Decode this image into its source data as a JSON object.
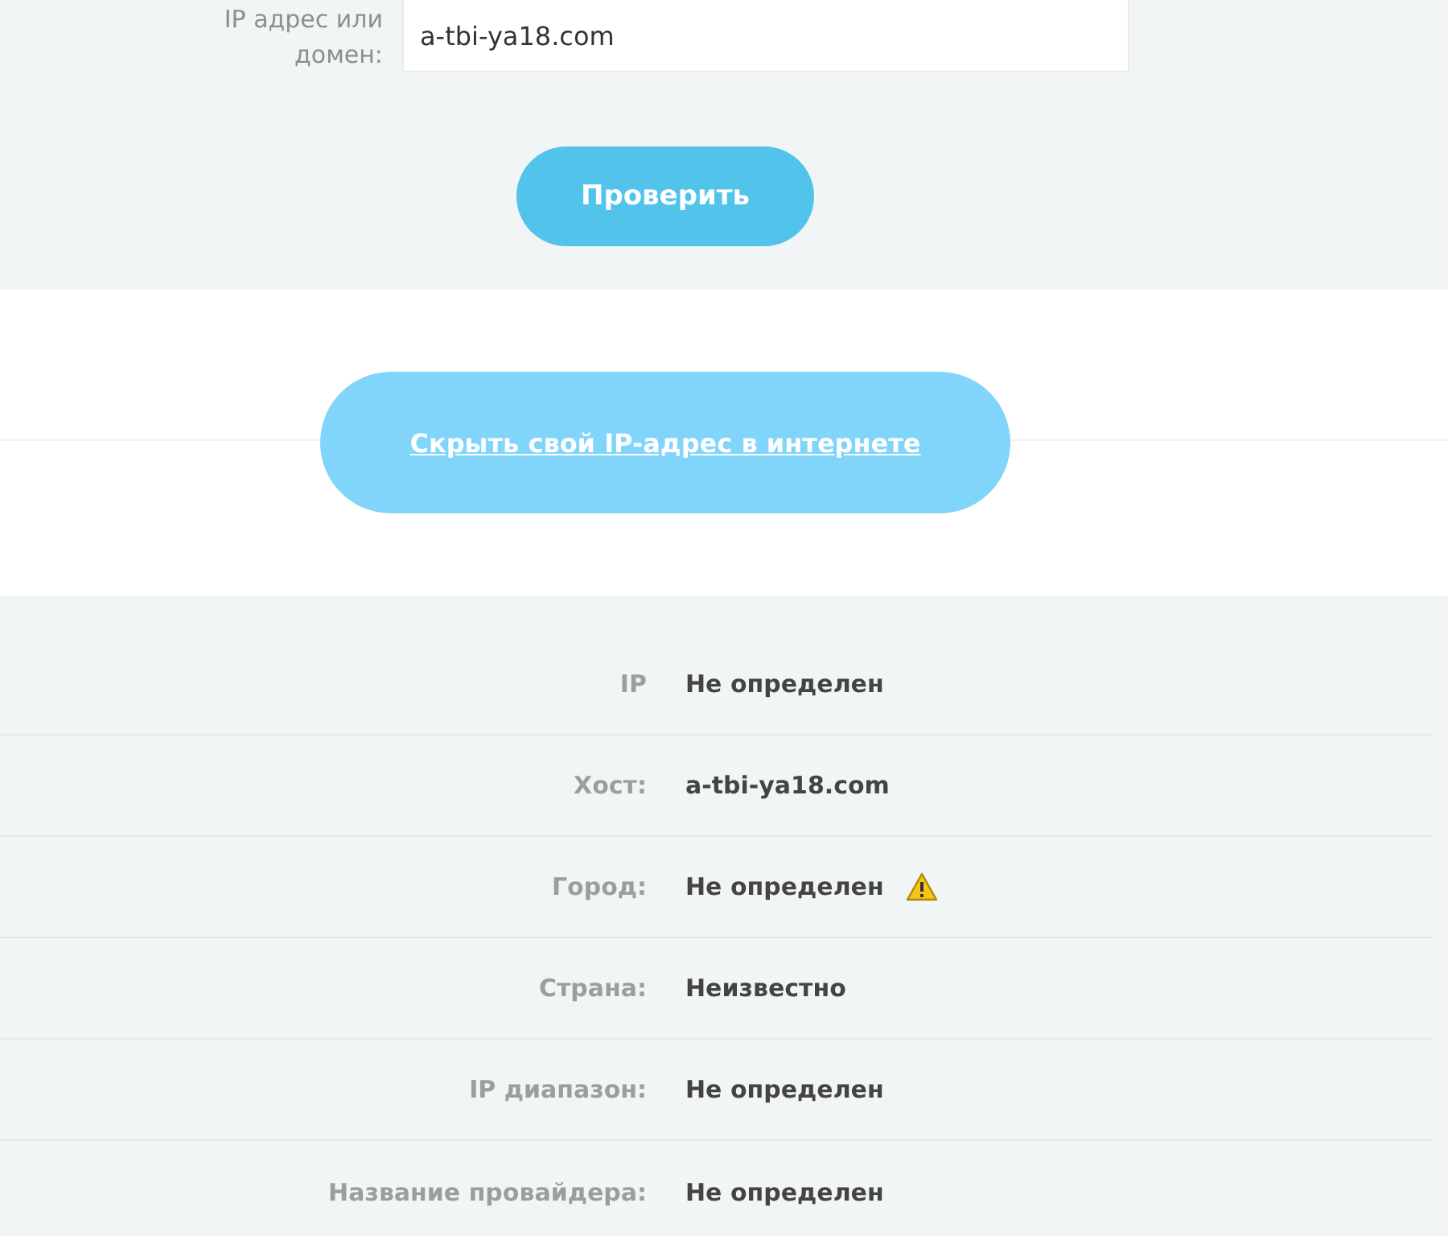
{
  "lookup_form": {
    "label": "IP адрес или домен:",
    "value": "a-tbi-ya18.com",
    "submit": "Проверить"
  },
  "hide_ip_button": {
    "label": "Скрыть свой IP-адрес в интернете"
  },
  "results": [
    {
      "label": "IP",
      "value": "Не определен",
      "warning": false
    },
    {
      "label": "Хост:",
      "value": "a-tbi-ya18.com",
      "warning": false
    },
    {
      "label": "Город:",
      "value": "Не определен",
      "warning": true
    },
    {
      "label": "Страна:",
      "value": "Неизвестно",
      "warning": false
    },
    {
      "label": "IP диапазон:",
      "value": "Не определен",
      "warning": false
    },
    {
      "label": "Название провайдера:",
      "value": "Не определен",
      "warning": false
    }
  ]
}
